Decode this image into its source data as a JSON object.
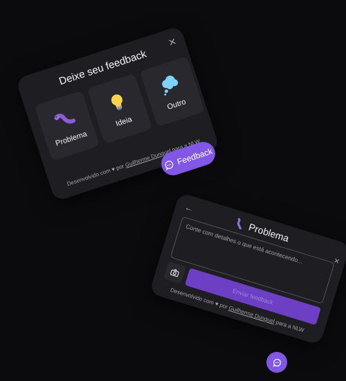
{
  "widget_main": {
    "title": "Deixe seu feedback",
    "close_icon": "✕",
    "types": [
      {
        "label": "Problema",
        "icon": "bug-icon"
      },
      {
        "label": "Ideia",
        "icon": "lightbulb-icon"
      },
      {
        "label": "Outro",
        "icon": "thought-cloud-icon"
      }
    ],
    "footer": {
      "prefix": "Desenvolvido com ♥ por ",
      "author": "Guilherme Dunguel",
      "suffix": " para a NLW"
    }
  },
  "feedback_button": {
    "label": "Feedback",
    "icon": "chat-bubble-icon"
  },
  "widget_form": {
    "back_icon": "←",
    "title": "Problema",
    "title_icon": "bug-icon",
    "textarea_placeholder": "Conte com detalhes o que está acontecendo...",
    "clear_icon": "✕",
    "screenshot_icon": "camera-icon",
    "submit_label": "Enviar feedback",
    "footer": {
      "prefix": "Desenvolvido com ♥ por ",
      "author": "Guilherme Dunguel",
      "suffix": " para a NLW"
    }
  },
  "small_button": {
    "icon": "chat-bubble-icon"
  },
  "colors": {
    "background": "#0b0a0d",
    "card": "#1e1d22",
    "tile": "#29282f",
    "brand": "#8257e5",
    "text": "#f4f4f5",
    "muted": "#a1a1aa"
  }
}
